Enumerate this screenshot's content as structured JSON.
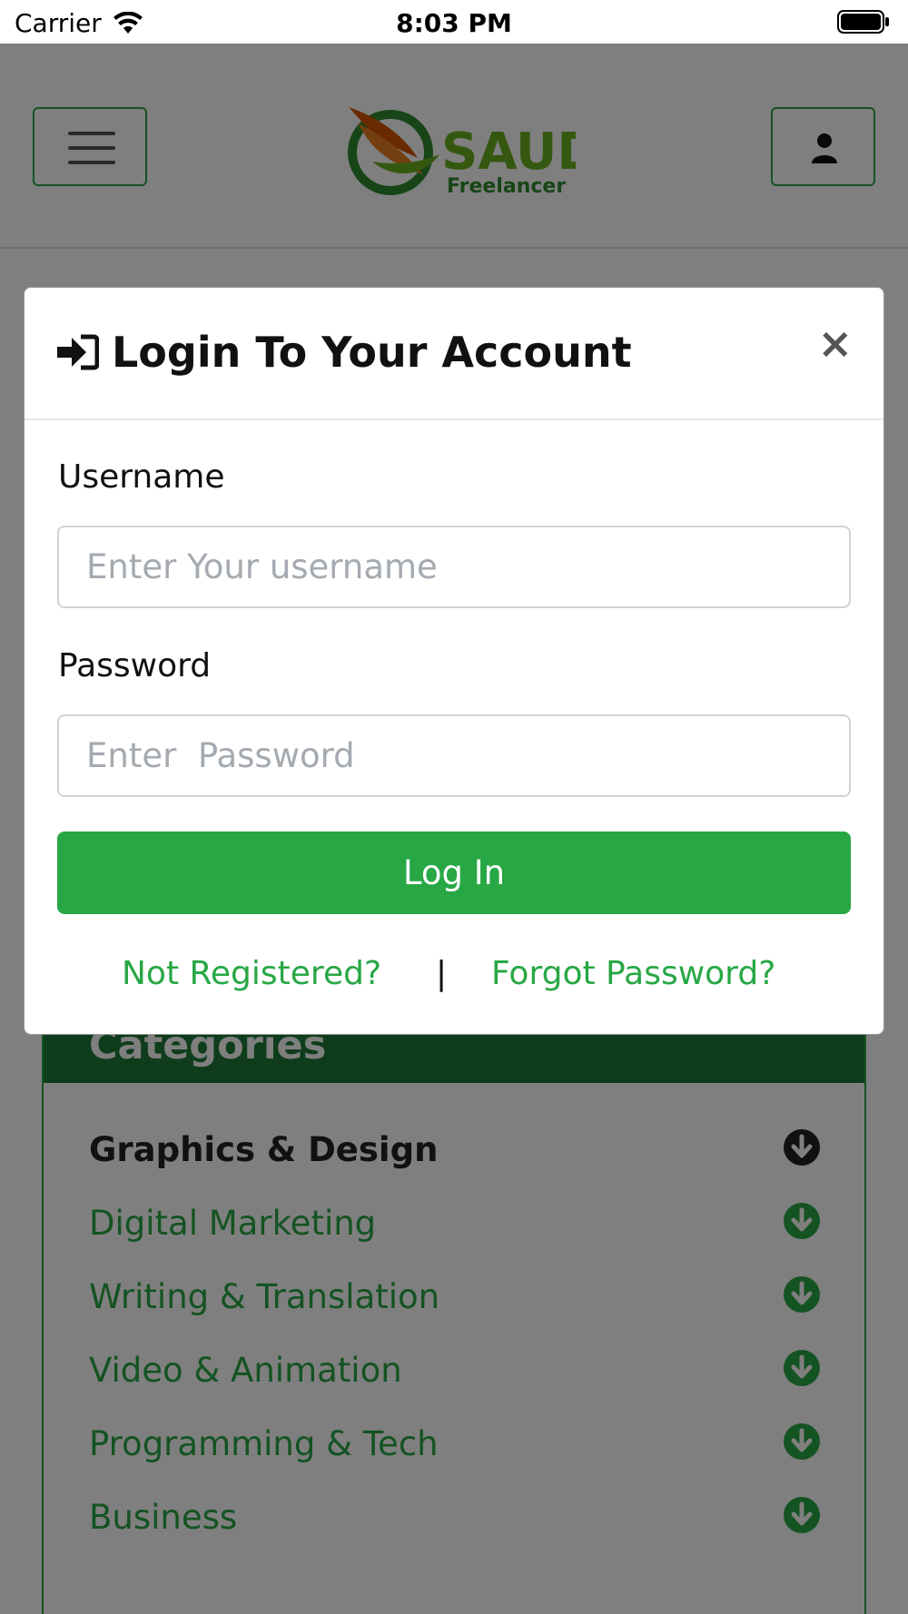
{
  "status_bar": {
    "carrier": "Carrier",
    "time": "8:03 PM",
    "wifi_icon": "wifi-icon",
    "battery_icon": "battery-icon"
  },
  "navbar": {
    "menu_icon": "hamburger-icon",
    "logo_text": "SAUDI",
    "logo_subtext": "Freelancer",
    "user_icon": "user-icon",
    "brand_color": "#28a745"
  },
  "modal": {
    "title_icon": "sign-in-icon",
    "title": "Login To Your Account",
    "close_label": "×",
    "username_label": "Username",
    "username_placeholder": "Enter Your username",
    "username_value": "",
    "password_label": "Password",
    "password_placeholder": "Enter  Password",
    "password_value": "",
    "login_button": "Log In",
    "not_registered_link": "Not Registered?",
    "separator": "|",
    "forgot_password_link": "Forgot Password?"
  },
  "categories": {
    "title": "Categories",
    "header_color": "#1f7a36",
    "items": [
      {
        "label": "Graphics & Design",
        "active": true
      },
      {
        "label": "Digital Marketing",
        "active": false
      },
      {
        "label": "Writing & Translation",
        "active": false
      },
      {
        "label": "Video & Animation",
        "active": false
      },
      {
        "label": "Programming & Tech",
        "active": false
      },
      {
        "label": "Business",
        "active": false
      }
    ]
  }
}
